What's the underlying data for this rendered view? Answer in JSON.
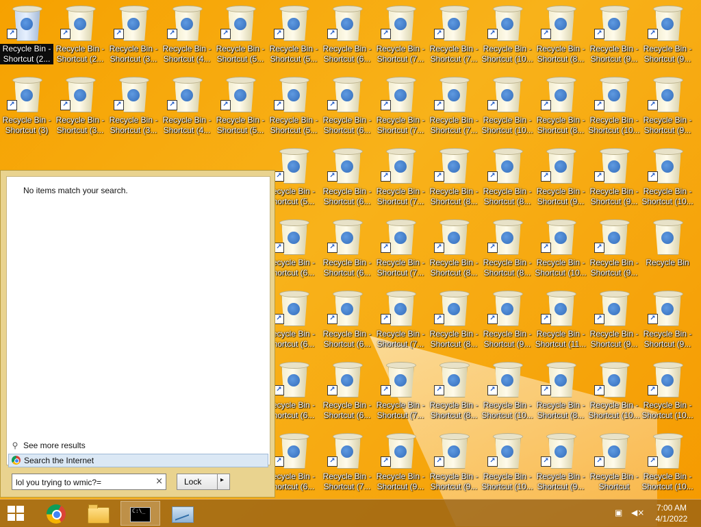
{
  "desktop": {
    "icons": [
      {
        "label": "Recycle Bin - Shortcut (2...",
        "short": true,
        "selected": true
      },
      {
        "label": "Recycle Bin - Shortcut (2...",
        "short": true
      },
      {
        "label": "Recycle Bin - Shortcut (3...",
        "short": true
      },
      {
        "label": "Recycle Bin - Shortcut (4...",
        "short": true
      },
      {
        "label": "Recycle Bin - Shortcut (5...",
        "short": true
      },
      {
        "label": "Recycle Bin - Shortcut (5...",
        "short": true
      },
      {
        "label": "Recycle Bin - Shortcut (6...",
        "short": true
      },
      {
        "label": "Recycle Bin - Shortcut (7...",
        "short": true
      },
      {
        "label": "Recycle Bin - Shortcut (7...",
        "short": true
      },
      {
        "label": "Recycle Bin - Shortcut (10...",
        "short": true
      },
      {
        "label": "Recycle Bin - Shortcut (8...",
        "short": true
      },
      {
        "label": "Recycle Bin - Shortcut (9...",
        "short": true
      },
      {
        "label": "Recycle Bin - Shortcut (9...",
        "short": true
      },
      {
        "label": "Recycle Bin - Shortcut (3)",
        "short": true
      },
      {
        "label": "Recycle Bin - Shortcut (3...",
        "short": true
      },
      {
        "label": "Recycle Bin - Shortcut (3...",
        "short": true
      },
      {
        "label": "Recycle Bin - Shortcut (4...",
        "short": true
      },
      {
        "label": "Recycle Bin - Shortcut (5...",
        "short": true
      },
      {
        "label": "Recycle Bin - Shortcut (5...",
        "short": true
      },
      {
        "label": "Recycle Bin - Shortcut (6...",
        "short": true
      },
      {
        "label": "Recycle Bin - Shortcut (7...",
        "short": true
      },
      {
        "label": "Recycle Bin - Shortcut (7...",
        "short": true
      },
      {
        "label": "Recycle Bin - Shortcut (10...",
        "short": true
      },
      {
        "label": "Recycle Bin - Shortcut (8...",
        "short": true
      },
      {
        "label": "Recycle Bin - Shortcut (10...",
        "short": true
      },
      {
        "label": "Recycle Bin - Shortcut (9...",
        "short": true
      },
      {
        "label": "ecycle Bin - hortcut (5...",
        "short": true
      },
      {
        "label": "Recycle Bin - Shortcut (6...",
        "short": true
      },
      {
        "label": "Recycle Bin - Shortcut (7...",
        "short": true
      },
      {
        "label": "Recycle Bin - Shortcut (8...",
        "short": true
      },
      {
        "label": "Recycle Bin - Shortcut (8...",
        "short": true
      },
      {
        "label": "Recycle Bin - Shortcut (9...",
        "short": true
      },
      {
        "label": "Recycle Bin - Shortcut (9...",
        "short": true
      },
      {
        "label": "Recycle Bin - Shortcut (10...",
        "short": true
      },
      {
        "label": "ecycle Bin - hortcut (6...",
        "short": true
      },
      {
        "label": "Recycle Bin - Shortcut (6...",
        "short": true
      },
      {
        "label": "Recycle Bin - Shortcut (7...",
        "short": true
      },
      {
        "label": "Recycle Bin - Shortcut (8...",
        "short": true
      },
      {
        "label": "Recycle Bin - Shortcut (8...",
        "short": true
      },
      {
        "label": "Recycle Bin - Shortcut (10...",
        "short": true
      },
      {
        "label": "Recycle Bin - Shortcut (9...",
        "short": true
      },
      {
        "label": "Recycle Bin",
        "short": false
      },
      {
        "label": "ecycle Bin - hortcut (6...",
        "short": true
      },
      {
        "label": "Recycle Bin - Shortcut (6...",
        "short": true
      },
      {
        "label": "Recycle Bin - Shortcut (7...",
        "short": true
      },
      {
        "label": "Recycle Bin - Shortcut (8...",
        "short": true
      },
      {
        "label": "Recycle Bin - Shortcut (9...",
        "short": true
      },
      {
        "label": "Recycle Bin - Shortcut (11...",
        "short": true
      },
      {
        "label": "Recycle Bin - Shortcut (9...",
        "short": true
      },
      {
        "label": "Recycle Bin - Shortcut (9...",
        "short": true
      },
      {
        "label": "ecycle Bin - hortcut (6...",
        "short": true
      },
      {
        "label": "Recycle Bin - Shortcut (6...",
        "short": true
      },
      {
        "label": "Recycle Bin - Shortcut (7...",
        "short": true
      },
      {
        "label": "Recycle Bin - Shortcut (8...",
        "short": true
      },
      {
        "label": "Recycle Bin - Shortcut (10...",
        "short": true
      },
      {
        "label": "Recycle Bin - Shortcut (8...",
        "short": true
      },
      {
        "label": "Recycle Bin - Shortcut (10...",
        "short": true
      },
      {
        "label": "Recycle Bin - Shortcut (10...",
        "short": true
      },
      {
        "label": "ecycle Bin - hortcut (6...",
        "short": true
      },
      {
        "label": "Recycle Bin - Shortcut (7...",
        "short": true
      },
      {
        "label": "Recycle Bin - Shortcut (9...",
        "short": true
      },
      {
        "label": "Recycle Bin - Shortcut (9...",
        "short": true
      },
      {
        "label": "Recycle Bin - Shortcut (10...",
        "short": true
      },
      {
        "label": "Recycle Bin - Shortcut (9...",
        "short": true
      },
      {
        "label": "Recycle Bin - Shortcut",
        "short": true
      },
      {
        "label": "Recycle Bin - Shortcut (10...",
        "short": true
      }
    ]
  },
  "search": {
    "no_items": "No items match your search.",
    "see_more": "See more results",
    "search_internet": "Search the Internet",
    "query": "lol you trying to wmic?=",
    "clear": "×",
    "lock_label": "Lock",
    "lock_arrow": "▸"
  },
  "taskbar": {
    "items": [
      "start-button",
      "chrome",
      "file-explorer",
      "command-prompt",
      "performance-monitor"
    ],
    "time": "7:00 AM",
    "date": "4/1/2022"
  },
  "colors": {
    "accent": "#f6a100",
    "taskbar": "#96601a"
  }
}
